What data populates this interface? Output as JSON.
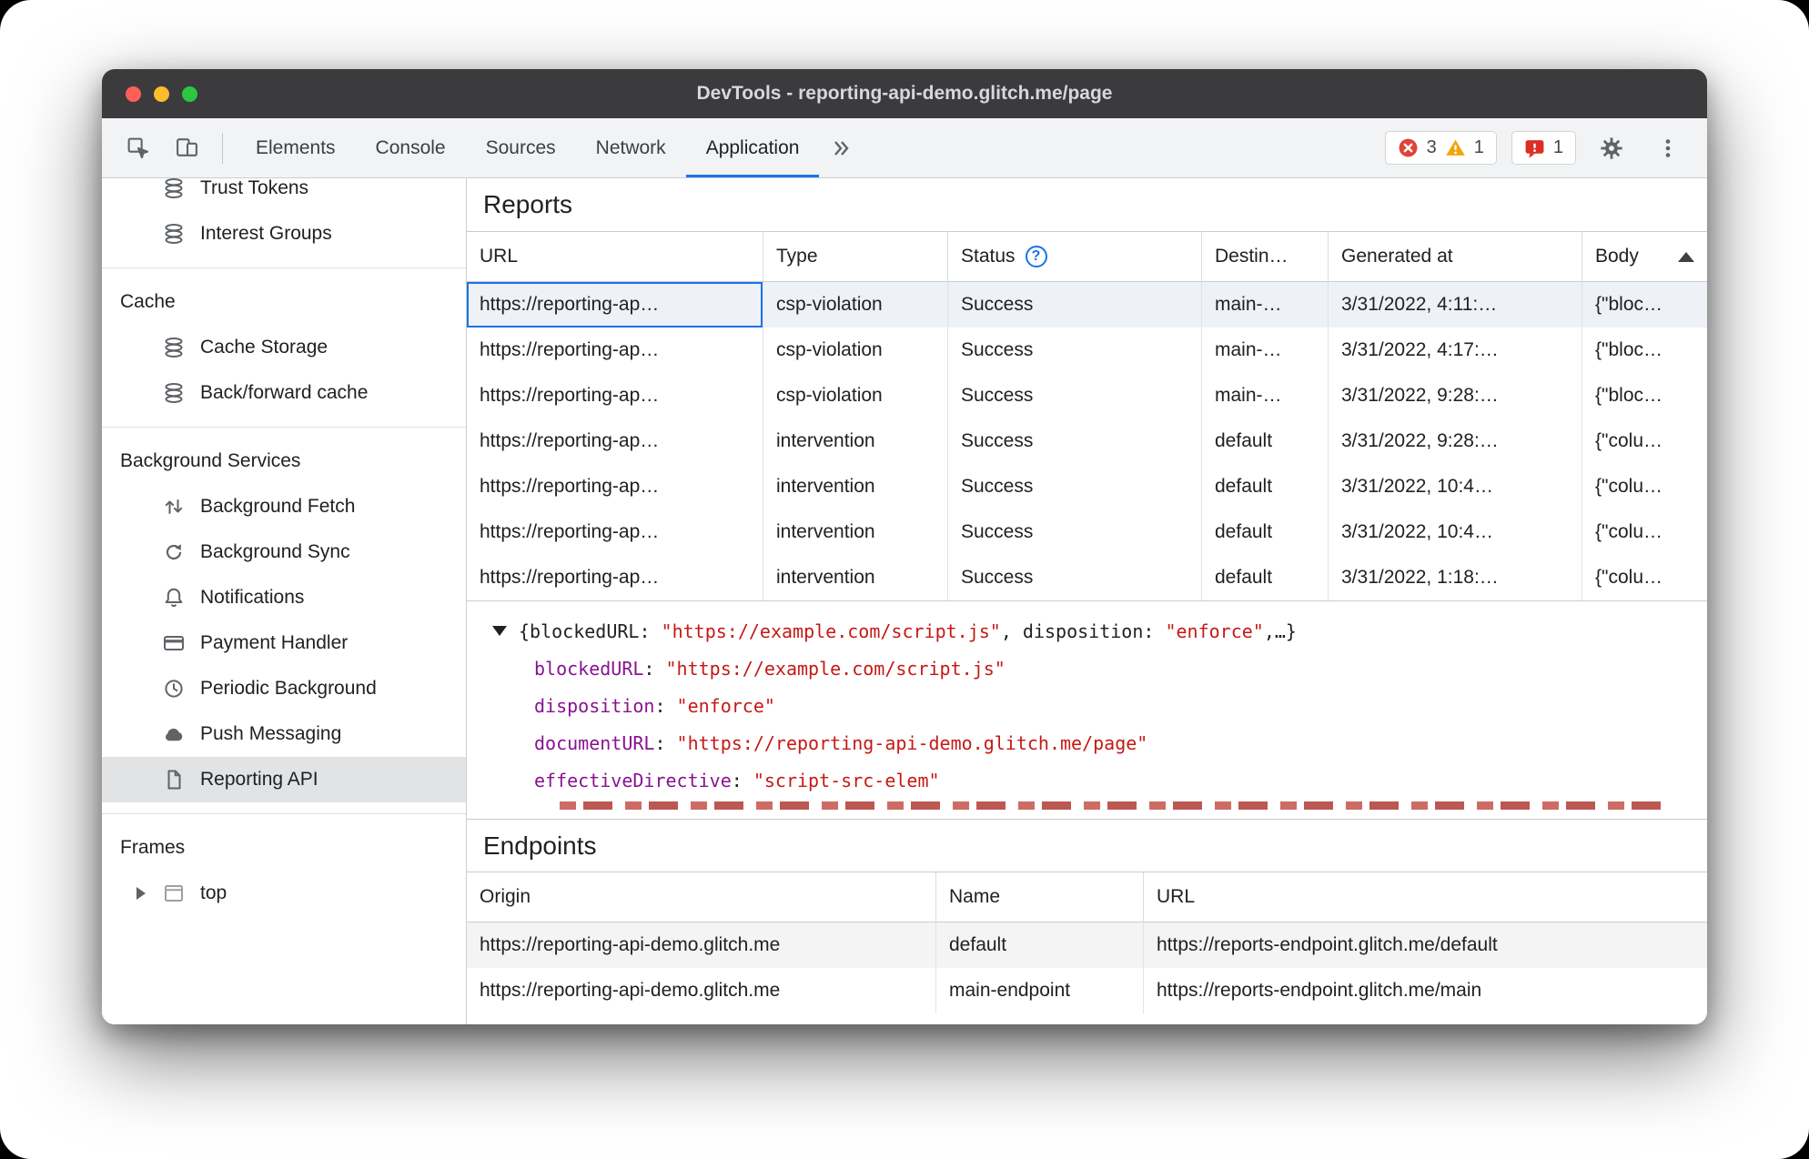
{
  "window": {
    "title": "DevTools - reporting-api-demo.glitch.me/page"
  },
  "toolbar": {
    "tabs": [
      "Elements",
      "Console",
      "Sources",
      "Network",
      "Application"
    ],
    "active_tab": "Application",
    "badges": {
      "errors": "3",
      "warnings": "1",
      "issues": "1"
    }
  },
  "sidebar": {
    "top_items": [
      {
        "label": "Trust Tokens"
      },
      {
        "label": "Interest Groups"
      }
    ],
    "cache": {
      "title": "Cache",
      "items": [
        {
          "label": "Cache Storage"
        },
        {
          "label": "Back/forward cache"
        }
      ]
    },
    "background_services": {
      "title": "Background Services",
      "selected": "Reporting API",
      "items": [
        {
          "label": "Background Fetch"
        },
        {
          "label": "Background Sync"
        },
        {
          "label": "Notifications"
        },
        {
          "label": "Payment Handler"
        },
        {
          "label": "Periodic Background"
        },
        {
          "label": "Push Messaging"
        },
        {
          "label": "Reporting API"
        }
      ]
    },
    "frames": {
      "title": "Frames",
      "items": [
        {
          "label": "top"
        }
      ]
    }
  },
  "reports": {
    "title": "Reports",
    "columns": {
      "url": "URL",
      "type": "Type",
      "status": "Status",
      "destination": "Destin…",
      "generated": "Generated at",
      "body": "Body"
    },
    "rows": [
      {
        "url": "https://reporting-ap…",
        "type": "csp-violation",
        "status": "Success",
        "destination": "main-…",
        "generated": "3/31/2022, 4:11:…",
        "body": "{\"bloc…"
      },
      {
        "url": "https://reporting-ap…",
        "type": "csp-violation",
        "status": "Success",
        "destination": "main-…",
        "generated": "3/31/2022, 4:17:…",
        "body": "{\"bloc…"
      },
      {
        "url": "https://reporting-ap…",
        "type": "csp-violation",
        "status": "Success",
        "destination": "main-…",
        "generated": "3/31/2022, 9:28:…",
        "body": "{\"bloc…"
      },
      {
        "url": "https://reporting-ap…",
        "type": "intervention",
        "status": "Success",
        "destination": "default",
        "generated": "3/31/2022, 9:28:…",
        "body": "{\"colu…"
      },
      {
        "url": "https://reporting-ap…",
        "type": "intervention",
        "status": "Success",
        "destination": "default",
        "generated": "3/31/2022, 10:4…",
        "body": "{\"colu…"
      },
      {
        "url": "https://reporting-ap…",
        "type": "intervention",
        "status": "Success",
        "destination": "default",
        "generated": "3/31/2022, 10:4…",
        "body": "{\"colu…"
      },
      {
        "url": "https://reporting-ap…",
        "type": "intervention",
        "status": "Success",
        "destination": "default",
        "generated": "3/31/2022, 1:18:…",
        "body": "{\"colu…"
      }
    ]
  },
  "detail": {
    "colon": ": ",
    "preview": {
      "p1": "{blockedURL: ",
      "v1": "\"https://example.com/script.js\"",
      "p2": ", disposition: ",
      "v2": "\"enforce\"",
      "p3": ",…}"
    },
    "fields": [
      {
        "key": "blockedURL",
        "value": "\"https://example.com/script.js\""
      },
      {
        "key": "disposition",
        "value": "\"enforce\""
      },
      {
        "key": "documentURL",
        "value": "\"https://reporting-api-demo.glitch.me/page\""
      },
      {
        "key": "effectiveDirective",
        "value": "\"script-src-elem\""
      }
    ]
  },
  "endpoints": {
    "title": "Endpoints",
    "columns": {
      "origin": "Origin",
      "name": "Name",
      "url": "URL"
    },
    "rows": [
      {
        "origin": "https://reporting-api-demo.glitch.me",
        "name": "default",
        "url": "https://reports-endpoint.glitch.me/default"
      },
      {
        "origin": "https://reporting-api-demo.glitch.me",
        "name": "main-endpoint",
        "url": "https://reports-endpoint.glitch.me/main"
      }
    ]
  },
  "colors": {
    "accent_blue": "#1a73e8",
    "error_red": "#de4437",
    "warning_yellow": "#f1a50b",
    "issue_red": "#d93025",
    "json_key_purple": "#881391",
    "json_string_red": "#c41a16",
    "titlebar_gray": "#3b3b3d"
  }
}
